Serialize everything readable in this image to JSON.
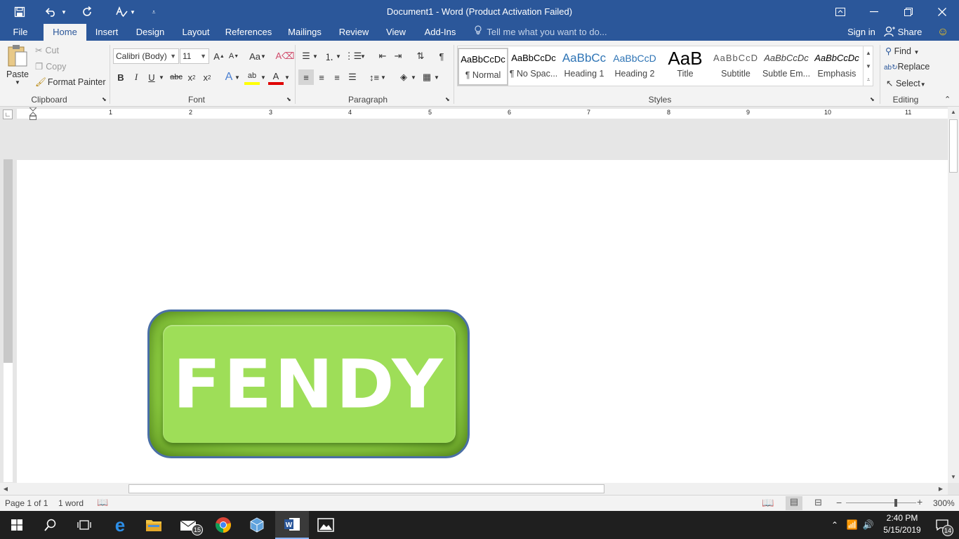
{
  "window": {
    "title": "Document1 - Word (Product Activation Failed)"
  },
  "tabs": [
    "File",
    "Home",
    "Insert",
    "Design",
    "Layout",
    "References",
    "Mailings",
    "Review",
    "View",
    "Add-Ins"
  ],
  "active_tab": "Home",
  "tell_me": "Tell me what you want to do...",
  "sign_in": "Sign in",
  "share": "Share",
  "clipboard": {
    "paste": "Paste",
    "cut": "Cut",
    "copy": "Copy",
    "format_painter": "Format Painter",
    "label": "Clipboard"
  },
  "font": {
    "name": "Calibri (Body)",
    "size": "11",
    "label": "Font"
  },
  "paragraph": {
    "label": "Paragraph"
  },
  "styles": {
    "label": "Styles",
    "items": [
      {
        "preview": "AaBbCcDc",
        "name": "¶ Normal"
      },
      {
        "preview": "AaBbCcDc",
        "name": "¶ No Spac..."
      },
      {
        "preview": "AaBbCc",
        "name": "Heading 1"
      },
      {
        "preview": "AaBbCcD",
        "name": "Heading 2"
      },
      {
        "preview": "AaB",
        "name": "Title"
      },
      {
        "preview": "AaBbCcD",
        "name": "Subtitle"
      },
      {
        "preview": "AaBbCcDc",
        "name": "Subtle Em..."
      },
      {
        "preview": "AaBbCcDc",
        "name": "Emphasis"
      }
    ]
  },
  "editing": {
    "find": "Find",
    "replace": "Replace",
    "select": "Select",
    "label": "Editing"
  },
  "ruler_numbers": [
    "1",
    "2",
    "3",
    "4",
    "5",
    "6",
    "7",
    "8",
    "9",
    "10",
    "11"
  ],
  "document": {
    "wordart": "FENDY"
  },
  "status": {
    "page": "Page 1 of 1",
    "words": "1 word",
    "zoom": "300%"
  },
  "taskbar": {
    "time": "2:40 PM",
    "date": "5/15/2019",
    "mail_badge": "15",
    "notif_badge": "14"
  }
}
